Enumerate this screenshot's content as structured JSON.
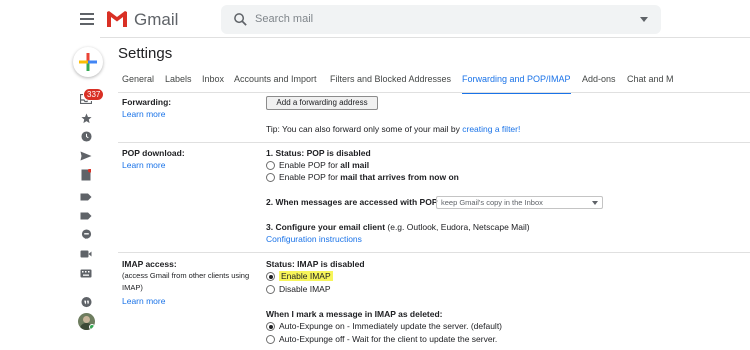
{
  "app": {
    "name": "Gmail",
    "brand_color": "#d93025",
    "accent": "#1a73e8"
  },
  "search": {
    "placeholder": "Search mail"
  },
  "rail": {
    "inbox_badge": "337"
  },
  "page": {
    "title": "Settings"
  },
  "tabs": [
    {
      "label": "General"
    },
    {
      "label": "Labels"
    },
    {
      "label": "Inbox"
    },
    {
      "label": "Accounts and Import"
    },
    {
      "label": "Filters and Blocked Addresses"
    },
    {
      "label": "Forwarding and POP/IMAP",
      "active": true
    },
    {
      "label": "Add-ons"
    },
    {
      "label": "Chat and M"
    }
  ],
  "forwarding": {
    "label": "Forwarding:",
    "learn_more": "Learn more",
    "button": "Add a forwarding address",
    "tip_prefix": "Tip: You can also forward only some of your mail by ",
    "tip_link": "creating a filter!"
  },
  "pop": {
    "label": "POP download:",
    "learn_more": "Learn more",
    "status_heading": "1. Status: POP is disabled",
    "opt1_prefix": "Enable POP for ",
    "opt1_bold": "all mail",
    "opt2_prefix": "Enable POP for ",
    "opt2_bold": "mail that arrives from now on",
    "access_heading": "2. When messages are accessed with POP",
    "access_select": "keep Gmail's copy in the Inbox",
    "client_heading": "3. Configure your email client",
    "client_suffix": " (e.g. Outlook, Eudora, Netscape Mail)",
    "config_link": "Configuration instructions"
  },
  "imap": {
    "label": "IMAP access:",
    "note": "(access Gmail from other clients using IMAP)",
    "learn_more": "Learn more",
    "status_heading": "Status: IMAP is disabled",
    "enable": "Enable IMAP",
    "disable": "Disable IMAP",
    "deleted_heading": "When I mark a message in IMAP as deleted:",
    "expunge_on": "Auto-Expunge on - Immediately update the server. (default)",
    "expunge_off": "Auto-Expunge off - Wait for the client to update the server."
  },
  "icons": [
    "menu-icon",
    "gmail-logo-icon",
    "search-icon",
    "compose-plus-icon",
    "inbox-icon",
    "star-icon",
    "clock-icon",
    "send-icon",
    "draft-icon",
    "label-icon",
    "chat-icon",
    "meet-icon",
    "keyboard-icon",
    "hangouts-icon",
    "avatar"
  ]
}
